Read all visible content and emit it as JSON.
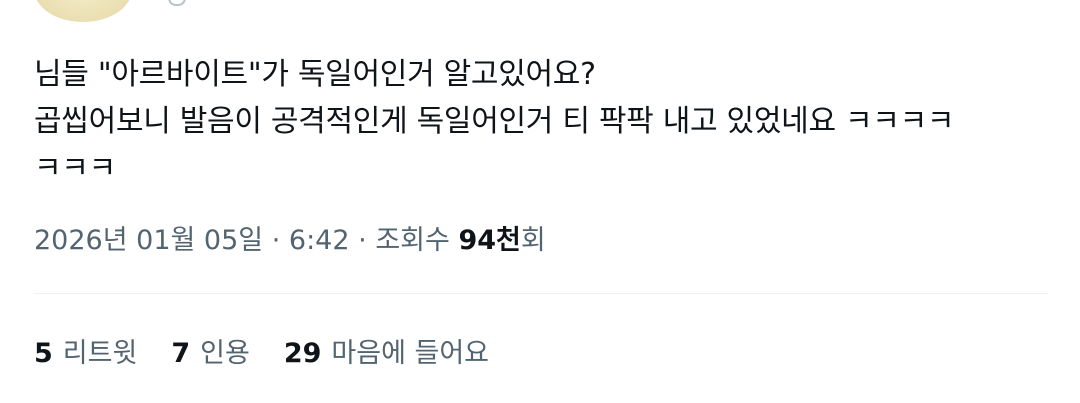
{
  "tweet": {
    "text_lines": [
      "님들 \"아르바이트\"가 독일어인거 알고있어요?",
      "곱씹어보니 발음이 공격적인게 독일어인거 티 팍팍 내고 있었네요 ㅋㅋㅋㅋ",
      "ㅋㅋㅋ"
    ]
  },
  "meta": {
    "date": "2026년 01월 05일",
    "separator": "·",
    "time": "6:42",
    "views_label": "조회수",
    "views_count": "94천",
    "views_suffix": "회"
  },
  "stats": {
    "retweets": {
      "count": "5",
      "label": "리트윗"
    },
    "quotes": {
      "count": "7",
      "label": "인용"
    },
    "likes": {
      "count": "29",
      "label": "마음에 들어요"
    }
  },
  "icons": {
    "avatar": "avatar-image"
  },
  "colors": {
    "text_primary": "#0f1419",
    "text_secondary": "#536471",
    "divider": "#eff3f4"
  }
}
